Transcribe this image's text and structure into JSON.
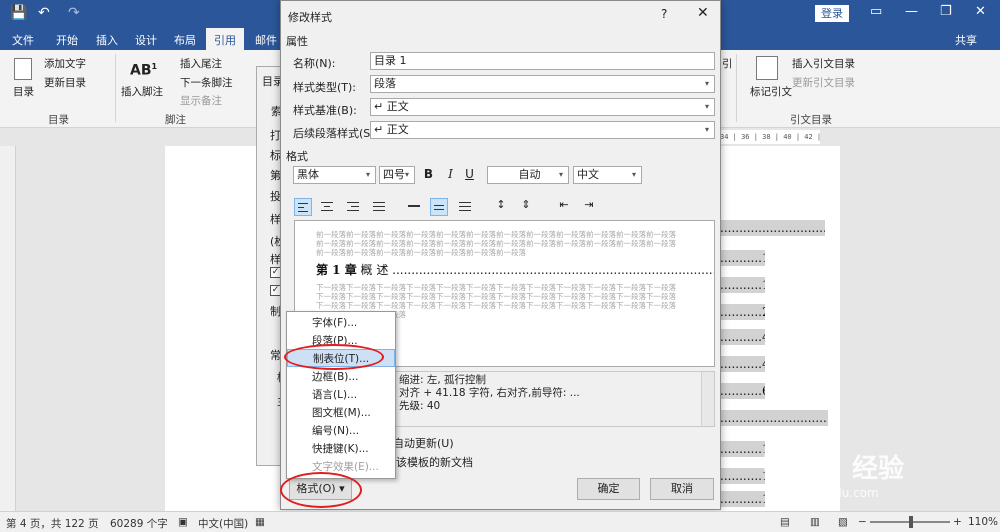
{
  "titlebar": {
    "login_label": "登录",
    "qa_save": "💾",
    "qa_undo": "↶",
    "qa_redo": "↷"
  },
  "tabs": [
    "文件",
    "开始",
    "插入",
    "设计",
    "布局",
    "引用",
    "邮件"
  ],
  "active_tab": "引用",
  "share_label": "共享",
  "ribbon": {
    "toc_label": "目录",
    "toc_group": "目录",
    "add_text": "添加文字",
    "update_toc": "更新目录",
    "insert_footnote": "插入脚注",
    "insert_endnote": "插入尾注",
    "next_footnote": "下一条脚注",
    "show_notes": "显示备注",
    "footnote_group": "脚注",
    "footnote_icon": "AB",
    "footnote_sup": "1",
    "mark_citation": "标记引文",
    "insert_toa": "插入引文目录",
    "update_toa": "更新引文目录",
    "toa_group": "引文目录",
    "cut_label": "引"
  },
  "ruler_text": "34 | 36 | 38 | 40 | 42 | 44",
  "bg_dialog": {
    "title_fragment": "目录",
    "tab_fragment": "索",
    "lines": [
      "打",
      "标",
      "第",
      "投",
      "样",
      "(枚",
      "样",
      "制",
      "常",
      "樗",
      "主"
    ]
  },
  "dialog": {
    "title": "修改样式",
    "help": "?",
    "close": "✕",
    "properties_heading": "属性",
    "name_label": "名称(N):",
    "name_value": "目录 1",
    "type_label": "样式类型(T):",
    "type_value": "段落",
    "base_label": "样式基准(B):",
    "base_value": "↵ 正文",
    "next_label": "后续段落样式(S):",
    "next_value": "↵ 正文",
    "format_heading": "格式",
    "font_value": "黑体",
    "size_value": "四号",
    "bold": "B",
    "italic": "I",
    "underline": "U",
    "color_value": "自动",
    "lang_value": "中文",
    "preview_prev": "前一段落前一段落前一段落前一段落前一段落前一段落前一段落前一段落前一段落前一段落前一段落前一段落前一段落前一段落前一段落前一段落前一段落前一段落前一段落前一段落前一段落前一段落前一段落前一段落前一段落前一段落前一段落前一段落前一段落前一段落前一段落",
    "preview_main_num": "第 1 章",
    "preview_main_text": " 概 述 ......................................................................................",
    "preview_next": "下一段落下一段落下一段落下一段落下一段落下一段落下一段落下一段落下一段落下一段落下一段落下一段落下一段落下一段落下一段落下一段落下一段落下一段落下一段落下一段落下一段落下一段落下一段落下一段落下一段落下一段落下一段落下一段落下一段落下一段落下一段落下一段落下一段落下一段落下一段落下一段落下一段落下一段落下一段落",
    "desc_line1": "缩进: 左, 孤行控制",
    "desc_line2": "对齐 + 41.18 字符, 右对齐,前导符: ...",
    "desc_line3": "先级: 40",
    "auto_update_label": "自动更新(U)",
    "new_doc_label": "于该模板的新文档",
    "format_button": "格式(O) ▾",
    "ok_button": "确定",
    "cancel_button": "取消"
  },
  "format_menu": {
    "items": [
      {
        "label": "字体(F)...",
        "state": "normal"
      },
      {
        "label": "段落(P)...",
        "state": "normal"
      },
      {
        "label": "制表位(T)...",
        "state": "highlighted"
      },
      {
        "label": "边框(B)...",
        "state": "normal"
      },
      {
        "label": "语言(L)...",
        "state": "normal"
      },
      {
        "label": "图文框(M)...",
        "state": "normal"
      },
      {
        "label": "编号(N)...",
        "state": "normal"
      },
      {
        "label": "快捷键(K)...",
        "state": "normal"
      },
      {
        "label": "文字效果(E)...",
        "state": "disabled"
      }
    ]
  },
  "document": {
    "toc_entries": [
      {
        "text": "..................................1",
        "level": 1
      },
      {
        "text": "...........1",
        "level": 2
      },
      {
        "text": "...........1",
        "level": 2
      },
      {
        "text": "...........2",
        "level": 2
      },
      {
        "text": "...........4",
        "level": 2
      },
      {
        "text": "...........4",
        "level": 2
      },
      {
        "text": "...........6",
        "level": 2
      },
      {
        "text": "..................................14",
        "level": 1
      },
      {
        "text": "...........14",
        "level": 2
      },
      {
        "text": "...........17",
        "level": 2
      },
      {
        "text": "...........17",
        "level": 2
      }
    ]
  },
  "status": {
    "page": "第 4 页，共 122 页",
    "words": "60289 个字",
    "lang": "中文(中国)",
    "zoom": "110%",
    "zoom_minus": "−",
    "zoom_plus": "+"
  },
  "watermark": {
    "brand": "Bai",
    "brand2": "经验",
    "url": "jingyan.baidu.com"
  }
}
